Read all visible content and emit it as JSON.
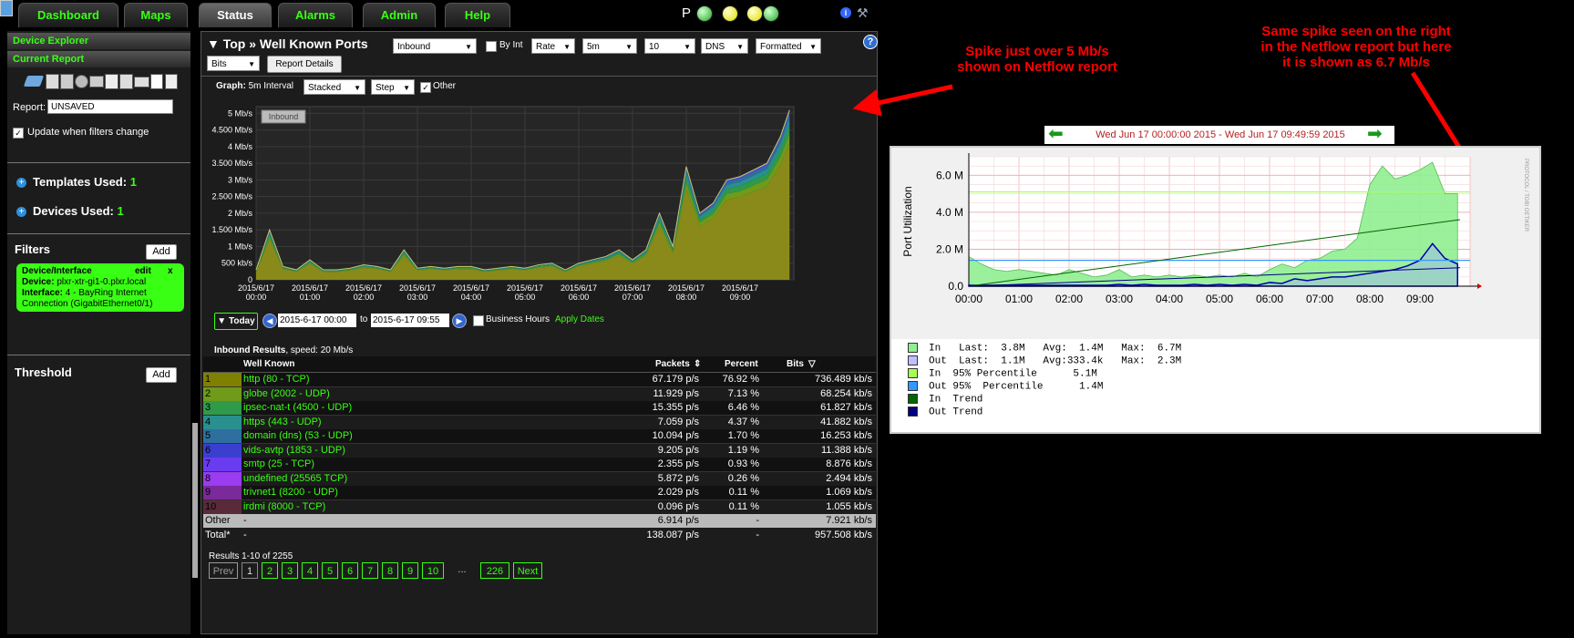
{
  "nav": {
    "tabs": [
      "Dashboard",
      "Maps",
      "Status",
      "Alarms",
      "Admin",
      "Help"
    ],
    "active": "Status",
    "p_label": "P"
  },
  "sidebar": {
    "device_explorer": "Device Explorer",
    "current_report": "Current Report",
    "report_label": "Report:",
    "report_value": "UNSAVED",
    "update_label": "Update when filters change",
    "templates_label": "Templates Used:",
    "templates_count": "1",
    "devices_label": "Devices Used:",
    "devices_count": "1",
    "filters_label": "Filters",
    "add_label": "Add",
    "filter_box": {
      "title": "Device/Interface",
      "edit": "edit",
      "close": "x",
      "device_label": "Device:",
      "device_value": "plxr-xtr-gi1-0.plxr.local",
      "interface_label": "Interface:",
      "interface_value": "4 - BayRing Internet Connection (GigabitEthernet0/1)"
    },
    "threshold_label": "Threshold"
  },
  "report": {
    "title": "▼ Top » Well Known Ports",
    "selects": [
      "Inbound",
      "Rate",
      "5m",
      "10",
      "DNS",
      "Formatted",
      "Bits"
    ],
    "by_int_label": "By Int",
    "report_details": "Report Details",
    "help_icon": "?",
    "graph_label": "Graph:",
    "graph_interval": "5m Interval",
    "graph_selects": [
      "Stacked",
      "Step"
    ],
    "other_label": "Other",
    "inbound_tag": "Inbound",
    "today_label": "▼ Today",
    "date_from": "2015-6-17 00:00",
    "to_label": "to",
    "date_to": "2015-6-17 09:55",
    "business_hours": "Business Hours",
    "apply_dates": "Apply Dates",
    "results_heading": "Inbound Results",
    "results_speed": ", speed: 20 Mb/s",
    "table_headers": [
      "Well Known",
      "Packets",
      "Percent",
      "Bits"
    ],
    "rows": [
      {
        "n": "1",
        "name": "http (80 - TCP)",
        "packets": "67.179 p/s",
        "percent": "76.92 %",
        "bits": "736.489 kb/s",
        "color": "#808000"
      },
      {
        "n": "2",
        "name": "globe (2002 - UDP)",
        "packets": "11.929 p/s",
        "percent": "7.13 %",
        "bits": "68.254 kb/s",
        "color": "#6f9a1a"
      },
      {
        "n": "3",
        "name": "ipsec-nat-t (4500 - UDP)",
        "packets": "15.355 p/s",
        "percent": "6.46 %",
        "bits": "61.827 kb/s",
        "color": "#2e9a4a"
      },
      {
        "n": "4",
        "name": "https (443 - UDP)",
        "packets": "7.059 p/s",
        "percent": "4.37 %",
        "bits": "41.882 kb/s",
        "color": "#2a8f8f"
      },
      {
        "n": "5",
        "name": "domain (dns) (53 - UDP)",
        "packets": "10.094 p/s",
        "percent": "1.70 %",
        "bits": "16.253 kb/s",
        "color": "#2e6fa0"
      },
      {
        "n": "6",
        "name": "vids-avtp (1853 - UDP)",
        "packets": "9.205 p/s",
        "percent": "1.19 %",
        "bits": "11.388 kb/s",
        "color": "#3b3fd0"
      },
      {
        "n": "7",
        "name": "smtp (25 - TCP)",
        "packets": "2.355 p/s",
        "percent": "0.93 %",
        "bits": "8.876 kb/s",
        "color": "#6a3cf0"
      },
      {
        "n": "8",
        "name": "undefined (25565 TCP)",
        "packets": "5.872 p/s",
        "percent": "0.26 %",
        "bits": "2.494 kb/s",
        "color": "#9a3cf0"
      },
      {
        "n": "9",
        "name": "trivnet1 (8200 - UDP)",
        "packets": "2.029 p/s",
        "percent": "0.11 %",
        "bits": "1.069 kb/s",
        "color": "#7a2a9a"
      },
      {
        "n": "10",
        "name": "irdmi (8000 - TCP)",
        "packets": "0.096 p/s",
        "percent": "0.11 %",
        "bits": "1.055 kb/s",
        "color": "#5a2a3a"
      }
    ],
    "other_row": {
      "name": "Other",
      "dash": "-",
      "packets": "6.914 p/s",
      "percent": "-",
      "bits": "7.921 kb/s"
    },
    "total_row": {
      "name": "Total*",
      "dash": "-",
      "packets": "138.087 p/s",
      "percent": "-",
      "bits": "957.508 kb/s"
    },
    "results_count": "Results 1-10 of 2255",
    "pagination": [
      "Prev",
      "1",
      "2",
      "3",
      "4",
      "5",
      "6",
      "7",
      "8",
      "9",
      "10",
      "...",
      "226",
      "Next"
    ]
  },
  "chart_data": [
    {
      "type": "area",
      "title": "",
      "y_ticks": [
        "5 Mb/s",
        "4.500 Mb/s",
        "4 Mb/s",
        "3.500 Mb/s",
        "3 Mb/s",
        "2.500 Mb/s",
        "2 Mb/s",
        "1.500 Mb/s",
        "1 Mb/s",
        "500 kb/s",
        "0"
      ],
      "x_ticks": [
        "2015/6/17 00:00",
        "2015/6/17 01:00",
        "2015/6/17 02:00",
        "2015/6/17 03:00",
        "2015/6/17 04:00",
        "2015/6/17 05:00",
        "2015/6/17 06:00",
        "2015/6/17 07:00",
        "2015/6/17 08:00",
        "2015/6/17 09:00"
      ],
      "ylim": [
        0,
        5.2
      ],
      "unit": "Mb/s",
      "stacked": true,
      "x_hours": [
        0,
        0.25,
        0.5,
        0.75,
        1,
        1.25,
        1.5,
        1.75,
        2,
        2.25,
        2.5,
        2.75,
        3,
        3.25,
        3.5,
        3.75,
        4,
        4.25,
        4.5,
        4.75,
        5,
        5.25,
        5.5,
        5.75,
        6,
        6.25,
        6.5,
        6.75,
        7,
        7.25,
        7.5,
        7.75,
        8,
        8.25,
        8.5,
        8.75,
        9,
        9.25,
        9.5,
        9.75,
        9.92
      ],
      "y_total": [
        0.3,
        1.5,
        0.4,
        0.3,
        0.6,
        0.3,
        0.3,
        0.35,
        0.45,
        0.4,
        0.3,
        0.9,
        0.35,
        0.4,
        0.35,
        0.4,
        0.4,
        0.3,
        0.35,
        0.4,
        0.35,
        0.45,
        0.5,
        0.3,
        0.5,
        0.6,
        0.7,
        0.9,
        0.6,
        0.9,
        2.0,
        1.0,
        3.4,
        2.0,
        2.3,
        3.0,
        3.1,
        3.3,
        3.5,
        4.3,
        5.1
      ]
    },
    {
      "type": "area",
      "title": "Wed Jun 17 00:00:00 2015 - Wed Jun 17 09:49:59 2015",
      "ylabel": "Port Utilization",
      "side_label": "PROTOCOL / TOBI OETIKER",
      "y_ticks": [
        "6.0 M",
        "4.0 M",
        "2.0 M",
        "0.0"
      ],
      "x_ticks": [
        "00:00",
        "01:00",
        "02:00",
        "03:00",
        "04:00",
        "05:00",
        "06:00",
        "07:00",
        "08:00",
        "09:00"
      ],
      "ylim": [
        0,
        7
      ],
      "x_hours": [
        0,
        0.25,
        0.5,
        0.75,
        1,
        1.25,
        1.5,
        1.75,
        2,
        2.25,
        2.5,
        2.75,
        3,
        3.25,
        3.5,
        3.75,
        4,
        4.25,
        4.5,
        4.75,
        5,
        5.25,
        5.5,
        5.75,
        6,
        6.25,
        6.5,
        6.75,
        7,
        7.25,
        7.5,
        7.75,
        8,
        8.25,
        8.5,
        8.75,
        9,
        9.25,
        9.5,
        9.75
      ],
      "in_values": [
        1.6,
        1.2,
        0.9,
        0.8,
        0.9,
        0.8,
        0.7,
        0.6,
        0.9,
        0.7,
        0.5,
        0.6,
        0.9,
        0.5,
        0.6,
        0.5,
        0.6,
        0.5,
        0.6,
        0.5,
        0.6,
        0.5,
        0.7,
        0.5,
        0.9,
        1.2,
        1.0,
        1.4,
        1.5,
        1.9,
        2.0,
        2.6,
        5.5,
        6.5,
        5.8,
        6.0,
        6.3,
        6.7,
        5.0,
        5.0
      ],
      "out_values": [
        0.05,
        0.05,
        0.05,
        0.05,
        0.05,
        0.05,
        0.05,
        0.05,
        0.05,
        0.05,
        0.05,
        0.05,
        0.1,
        0.05,
        0.1,
        0.05,
        0.05,
        0.05,
        0.1,
        0.05,
        0.1,
        0.05,
        0.1,
        0.05,
        0.2,
        0.15,
        0.4,
        0.3,
        0.4,
        0.5,
        0.5,
        0.6,
        0.7,
        0.8,
        0.9,
        1.1,
        1.4,
        2.3,
        1.5,
        1.2
      ],
      "in_95": 5.1,
      "out_95": 1.4,
      "in_trend": [
        0.0,
        3.6
      ],
      "out_trend": [
        0.0,
        1.0
      ],
      "colors": {
        "in": "#90ee90",
        "out": "#0000aa",
        "in95": "#aaff55",
        "out95": "#3399ff",
        "in_trend": "#006600",
        "out_trend": "#000080"
      },
      "legend": [
        "In   Last:  3.8M   Avg:  1.4M   Max:  6.7M",
        "Out  Last:  1.1M   Avg:333.4k   Max:  2.3M",
        "In  95% Percentile      5.1M",
        "Out 95%  Percentile      1.4M",
        "In  Trend",
        "Out Trend"
      ]
    }
  ],
  "annotations": {
    "left": "Spike just over 5 Mb/s\nshown on Netflow report",
    "right": "Same spike seen on the right\nin the Netflow report but here\nit is shown as 6.7 Mb/s"
  },
  "colors": {
    "accent": "#39ff14",
    "annotation": "#ff0000",
    "panel": "#1c1c1c"
  }
}
